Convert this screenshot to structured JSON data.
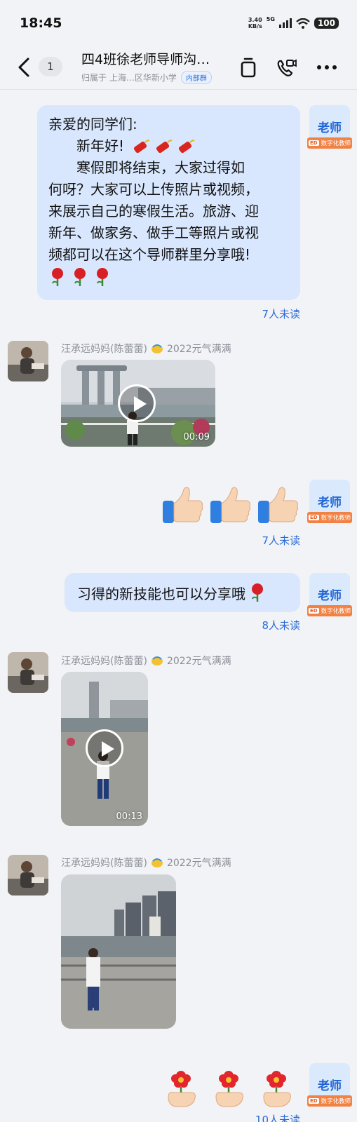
{
  "status_bar": {
    "time": "18:45",
    "net_speed": "3.40",
    "net_unit": "KB/s",
    "network": "5G",
    "battery": "100"
  },
  "header": {
    "unread_count": "1",
    "title": "四4班徐老师导师沟…",
    "subtitle": "归属于 上海…区华新小学",
    "tag": "内部群",
    "icons": [
      "back-arrow-icon",
      "copy-icon",
      "video-call-icon",
      "more-icon"
    ]
  },
  "messages": [
    {
      "side": "right",
      "sender_label": "老师",
      "badge_logo": "ED",
      "badge": "数字化教师",
      "lines": [
        "亲爱的同学们:",
        "　　新年好!",
        "　　寒假即将结束，大家过得如",
        "何呀？大家可以上传照片或视频，",
        "来展示自己的寒假生活。旅游、迎",
        "新年、做家务、做手工等照片或视",
        "频都可以在这个导师群里分享哦!"
      ],
      "emoji_inline": [
        "firecracker",
        "firecracker",
        "firecracker"
      ],
      "emoji_trailing": [
        "rose",
        "rose",
        "rose"
      ],
      "read_status": "7人未读"
    },
    {
      "side": "left",
      "sender": "汪承远妈妈(陈蕾蕾)",
      "medal_label": "2022元气满满",
      "type": "video",
      "duration": "00:09"
    },
    {
      "side": "right",
      "sender_label": "老师",
      "badge_logo": "ED",
      "badge": "数字化教师",
      "emoji": [
        "thumbs-up",
        "thumbs-up",
        "thumbs-up"
      ],
      "read_status": "7人未读"
    },
    {
      "side": "right",
      "sender_label": "老师",
      "badge_logo": "ED",
      "badge": "数字化教师",
      "text": "习得的新技能也可以分享哦",
      "emoji_trailing": [
        "rose"
      ],
      "read_status": "8人未读"
    },
    {
      "side": "left",
      "sender": "汪承远妈妈(陈蕾蕾)",
      "medal_label": "2022元气满满",
      "type": "video",
      "duration": "00:13"
    },
    {
      "side": "left",
      "sender": "汪承远妈妈(陈蕾蕾)",
      "medal_label": "2022元气满满",
      "type": "image"
    },
    {
      "side": "right",
      "sender_label": "老师",
      "badge_logo": "ED",
      "badge": "数字化教师",
      "emoji": [
        "flower-hand",
        "flower-hand",
        "flower-hand"
      ],
      "read_status": "10人未读"
    }
  ],
  "colors": {
    "background": "#f2f3f6",
    "bubble": "#d8e7fd",
    "accent_blue": "#2b6bd6",
    "badge_orange": "#f28244"
  }
}
